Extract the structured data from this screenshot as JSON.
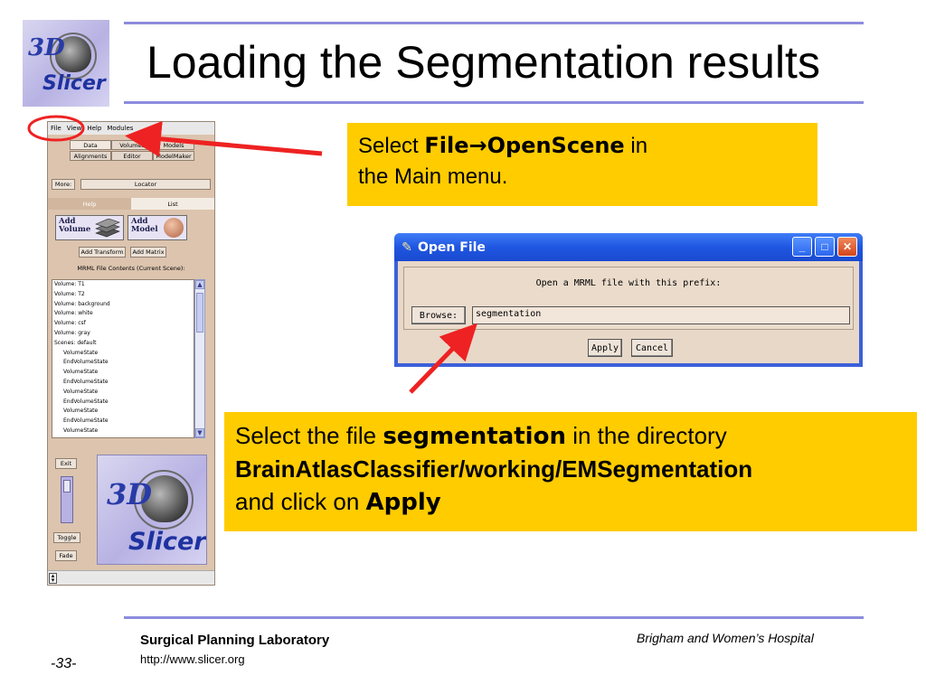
{
  "slide": {
    "title": "Loading the Segmentation results",
    "logo": {
      "text_3d": "3D",
      "text_slicer": "Slicer"
    }
  },
  "slicer_window": {
    "menu": [
      "File",
      "View",
      "Help",
      "Modules"
    ],
    "tabs_row1": [
      "Data",
      "Volumes",
      "Models"
    ],
    "tabs_row2": [
      "Alignments",
      "Editor",
      "ModelMaker"
    ],
    "more_label": "More:",
    "locator_label": "Locator",
    "help_tab": "Help",
    "list_tab": "List",
    "add_volume": [
      "Add",
      "Volume"
    ],
    "add_model": [
      "Add",
      "Model"
    ],
    "add_transform": "Add Transform",
    "add_matrix": "Add Matrix",
    "mrml_label": "MRML File Contents (Current Scene):",
    "list_items": [
      {
        "text": "Volume: T1",
        "indent": false
      },
      {
        "text": "Volume: T2",
        "indent": false
      },
      {
        "text": "Volume: background",
        "indent": false
      },
      {
        "text": "Volume: white",
        "indent": false
      },
      {
        "text": "Volume: csf",
        "indent": false
      },
      {
        "text": "Volume: gray",
        "indent": false
      },
      {
        "text": "Scenes: default",
        "indent": false
      },
      {
        "text": "VolumeState",
        "indent": true
      },
      {
        "text": "EndVolumeState",
        "indent": true
      },
      {
        "text": "VolumeState",
        "indent": true
      },
      {
        "text": "EndVolumeState",
        "indent": true
      },
      {
        "text": "VolumeState",
        "indent": true
      },
      {
        "text": "EndVolumeState",
        "indent": true
      },
      {
        "text": "VolumeState",
        "indent": true
      },
      {
        "text": "EndVolumeState",
        "indent": true
      },
      {
        "text": "VolumeState",
        "indent": true
      }
    ],
    "exit_label": "Exit",
    "toggle_label": "Toggle",
    "fade_label": "Fade"
  },
  "callout1": {
    "pre": "Select ",
    "bold_file": "File",
    "arrow": "→",
    "bold_openscene": "OpenScene",
    "mid": " in",
    "line2": "the Main menu."
  },
  "dialog": {
    "title": "Open File",
    "prompt": "Open a MRML file with this prefix:",
    "browse_label": "Browse:",
    "prefix_value": "segmentation",
    "apply_label": "Apply",
    "cancel_label": "Cancel"
  },
  "callout2": {
    "pre": "Select the file ",
    "bold_file": "segmentation",
    "post": " in the directory",
    "bold_path": "BrainAtlasClassifier/working/EMSegmentation",
    "line3_pre": "and click on ",
    "bold_apply": "Apply"
  },
  "footer": {
    "lab": "Surgical Planning Laboratory",
    "url": "http://www.slicer.org",
    "hospital": "Brigham and Women’s Hospital",
    "page": "-33-"
  },
  "colors": {
    "callout": "#ffcc00",
    "rule": "#8c8cde",
    "annotation_red": "#ee2222",
    "xp_blue": "#1f56e0"
  }
}
